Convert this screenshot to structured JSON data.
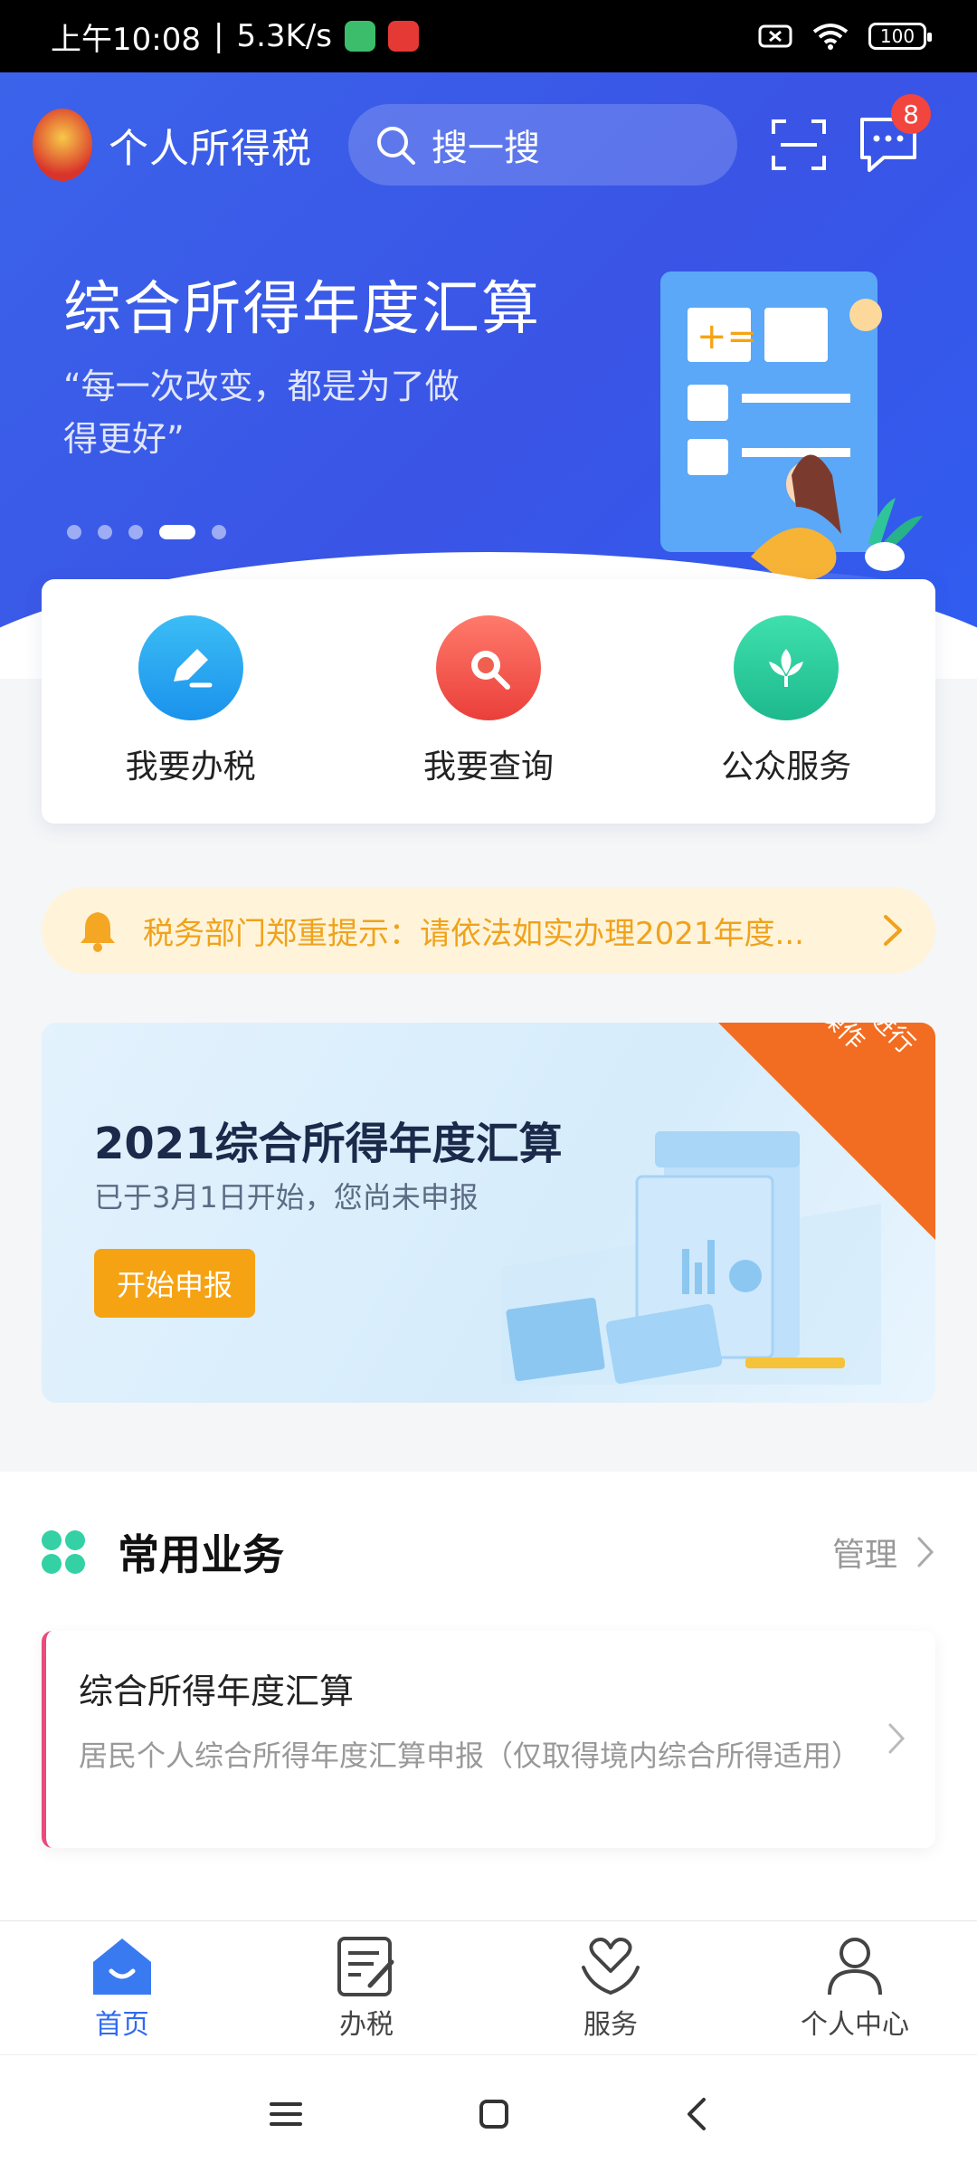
{
  "status_bar": {
    "time": "上午10:08",
    "speed": "5.3K/s",
    "battery": "100"
  },
  "header": {
    "title": "个人所得税",
    "search_placeholder": "搜一搜",
    "message_count": "8"
  },
  "hero": {
    "headline": "综合所得年度汇算",
    "quote": "“每一次改变，都是为了做得更好”",
    "carousel": {
      "total": 5,
      "active": 4
    }
  },
  "quick_actions": [
    {
      "label": "我要办税",
      "icon": "pencil-icon",
      "color": "#1aa3f1"
    },
    {
      "label": "我要查询",
      "icon": "magnifier-icon",
      "color": "#f2574c"
    },
    {
      "label": "公众服务",
      "icon": "lotus-icon",
      "color": "#29c59a"
    }
  ],
  "notice": {
    "text": "税务部门郑重提示：请依法如实办理2021年度..."
  },
  "promo_banner": {
    "title": "2021综合所得年度汇算",
    "subtitle": "已于3月1日开始，您尚未申报",
    "button": "开始申报",
    "corner_text": "进入专题页进行更多操作"
  },
  "common_services": {
    "title": "常用业务",
    "manage": "管理",
    "items": [
      {
        "title": "综合所得年度汇算",
        "description": "居民个人综合所得年度汇算申报（仅取得境内综合所得适用）"
      }
    ]
  },
  "bottom_nav": [
    {
      "label": "首页",
      "icon": "home-icon",
      "active": true
    },
    {
      "label": "办税",
      "icon": "document-edit-icon",
      "active": false
    },
    {
      "label": "服务",
      "icon": "heart-hands-icon",
      "active": false
    },
    {
      "label": "个人中心",
      "icon": "person-icon",
      "active": false
    }
  ],
  "colors": {
    "primary": "#3a5ce9",
    "accent_orange": "#f6a313",
    "notice_bg": "#fff4d9",
    "active_nav": "#2f6bf1"
  }
}
